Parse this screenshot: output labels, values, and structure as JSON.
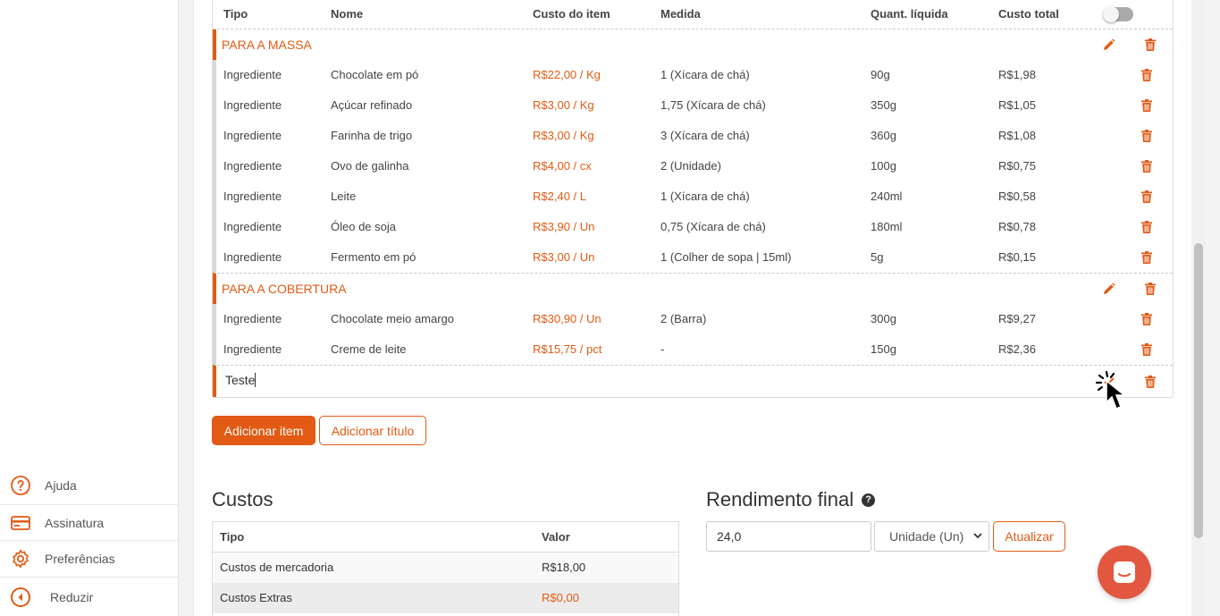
{
  "sidebar": {
    "items": [
      {
        "label": "Ajuda",
        "icon": "help-icon"
      },
      {
        "label": "Assinatura",
        "icon": "credit-card-icon"
      },
      {
        "label": "Preferências",
        "icon": "gear-icon"
      },
      {
        "label": "Reduzir",
        "icon": "collapse-icon"
      }
    ]
  },
  "table": {
    "headers": {
      "tipo": "Tipo",
      "nome": "Nome",
      "custo": "Custo do item",
      "medida": "Medida",
      "quant": "Quant. líquida",
      "total": "Custo total"
    },
    "toggle_on": false,
    "section1": {
      "title": "PARA A MASSA",
      "items": [
        {
          "tipo": "Ingrediente",
          "nome": "Chocolate em pó",
          "custo": "R$22,00 / Kg",
          "medida": "1 (Xícara de chá)",
          "quant": "90g",
          "total": "R$1,98"
        },
        {
          "tipo": "Ingrediente",
          "nome": "Açúcar refinado",
          "custo": "R$3,00 / Kg",
          "medida": "1,75 (Xícara de chá)",
          "quant": "350g",
          "total": "R$1,05"
        },
        {
          "tipo": "Ingrediente",
          "nome": "Farinha de trigo",
          "custo": "R$3,00 / Kg",
          "medida": "3 (Xícara de chá)",
          "quant": "360g",
          "total": "R$1,08"
        },
        {
          "tipo": "Ingrediente",
          "nome": "Ovo de galinha",
          "custo": "R$4,00 / cx",
          "medida": "2 (Unidade)",
          "quant": "100g",
          "total": "R$0,75"
        },
        {
          "tipo": "Ingrediente",
          "nome": "Leite",
          "custo": "R$2,40 / L",
          "medida": "1 (Xícara de chá)",
          "quant": "240ml",
          "total": "R$0,58"
        },
        {
          "tipo": "Ingrediente",
          "nome": "Óleo de soja",
          "custo": "R$3,90 / Un",
          "medida": "0,75 (Xícara de chá)",
          "quant": "180ml",
          "total": "R$0,78"
        },
        {
          "tipo": "Ingrediente",
          "nome": "Fermento em pó",
          "custo": "R$3,00 / Un",
          "medida": "1 (Colher de sopa | 15ml)",
          "quant": "5g",
          "total": "R$0,15"
        }
      ]
    },
    "section2": {
      "title": "PARA A COBERTURA",
      "items": [
        {
          "tipo": "Ingrediente",
          "nome": "Chocolate meio amargo",
          "custo": "R$30,90 / Un",
          "medida": "2 (Barra)",
          "quant": "300g",
          "total": "R$9,27"
        },
        {
          "tipo": "Ingrediente",
          "nome": "Creme de leite",
          "custo": "R$15,75 / pct",
          "medida": "-",
          "quant": "150g",
          "total": "R$2,36"
        }
      ]
    },
    "editing_title": "Teste"
  },
  "buttons": {
    "add_item": "Adicionar item",
    "add_title": "Adicionar título",
    "update": "Atualizar"
  },
  "costs": {
    "heading": "Custos",
    "col_tipo": "Tipo",
    "col_valor": "Valor",
    "rows": [
      {
        "tipo": "Custos de mercadoria",
        "valor": "R$18,00"
      },
      {
        "tipo": "Custos Extras",
        "valor": "R$0,00"
      }
    ]
  },
  "yield": {
    "heading": "Rendimento final",
    "help": "?",
    "value": "24,0",
    "unit": "Unidade (Un)"
  },
  "colors": {
    "accent": "#e25a14",
    "chat": "#e2573f"
  }
}
